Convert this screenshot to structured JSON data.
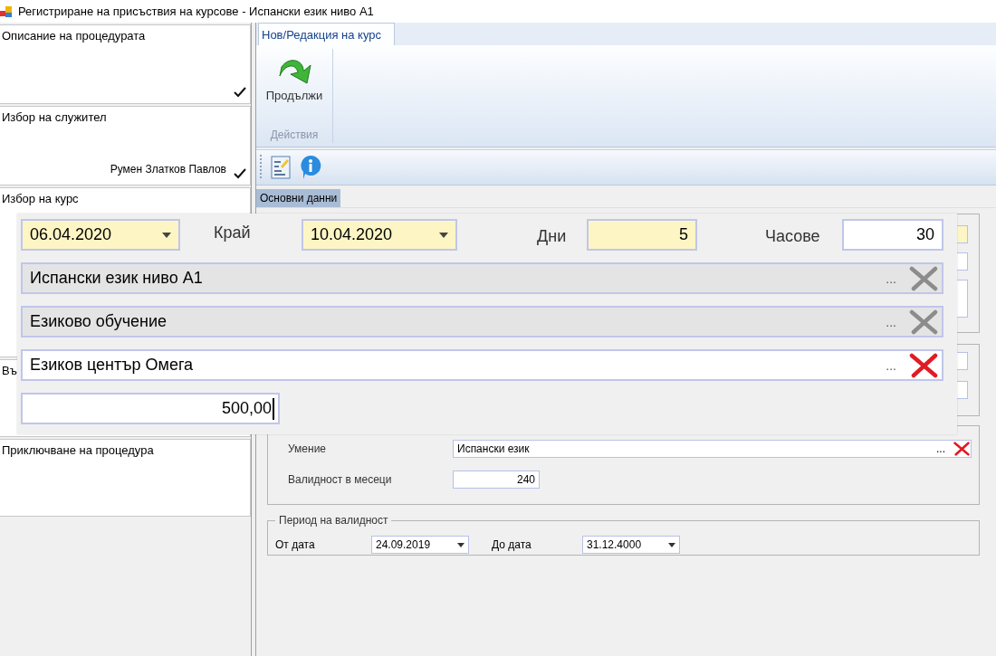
{
  "window": {
    "title": "Регистриране на присъствия на курсове - Испански език ниво А1"
  },
  "steps": [
    {
      "title": "Описание на процедурата",
      "done": true
    },
    {
      "title": "Избор на служител",
      "value": "Румен Златков Павлов",
      "done": true
    },
    {
      "title": "Избор на курс"
    },
    {
      "title": "Въ"
    },
    {
      "title": "Приключване на процедура",
      "done": false
    }
  ],
  "ribbon": {
    "tab": "Нов/Редакция на курс",
    "button": "Продължи",
    "group": "Действия"
  },
  "form_tabs": [
    {
      "label": "Основни данни",
      "selected": true
    }
  ],
  "skill_group": {
    "skill_label": "Умение",
    "skill": "Испански език",
    "skill_browse": "...",
    "validity_label": "Валидност в месеци",
    "validity": "240"
  },
  "validity_period": {
    "legend": "Период на валидност",
    "from_label": "От дата",
    "from": "24.09.2019",
    "to_label": "До дата",
    "to": "31.12.4000"
  },
  "zoom_overlay": {
    "start_date": "06.04.2020",
    "end_label": "Край",
    "end_date": "10.04.2020",
    "days_label": "Дни",
    "days": "5",
    "hours_label": "Часове",
    "hours": "30",
    "lookups": [
      {
        "value": "Испански език ниво А1",
        "browse": "...",
        "disabled": true
      },
      {
        "value": "Езиково обучение",
        "browse": "...",
        "disabled": true
      },
      {
        "value": "Езиков център Омега",
        "browse": "...",
        "disabled": false
      }
    ],
    "price": "500,00"
  }
}
